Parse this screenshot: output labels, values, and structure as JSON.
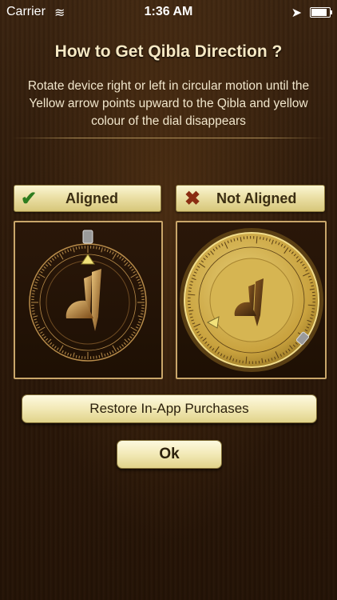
{
  "status_bar": {
    "carrier": "Carrier",
    "wifi_icon": "≋",
    "time": "1:36 AM",
    "location_icon": "➤",
    "battery_level": 0.85
  },
  "title": "How to Get Qibla Direction ?",
  "instructions": "Rotate device right or left in circular motion until the Yellow arrow points upward to the Qibla and yellow colour of the dial disappears",
  "aligned": {
    "label": "Aligned",
    "icon": "check-icon",
    "icon_glyph": "✔"
  },
  "not_aligned": {
    "label": "Not Aligned",
    "icon": "x-icon",
    "icon_glyph": "✖"
  },
  "buttons": {
    "restore": "Restore In-App Purchases",
    "ok": "Ok"
  },
  "colors": {
    "background": "#2e1a0a",
    "gold": "#c9a66a",
    "button": "#f2e9b6",
    "dial_yellow": "#d8b84a"
  }
}
